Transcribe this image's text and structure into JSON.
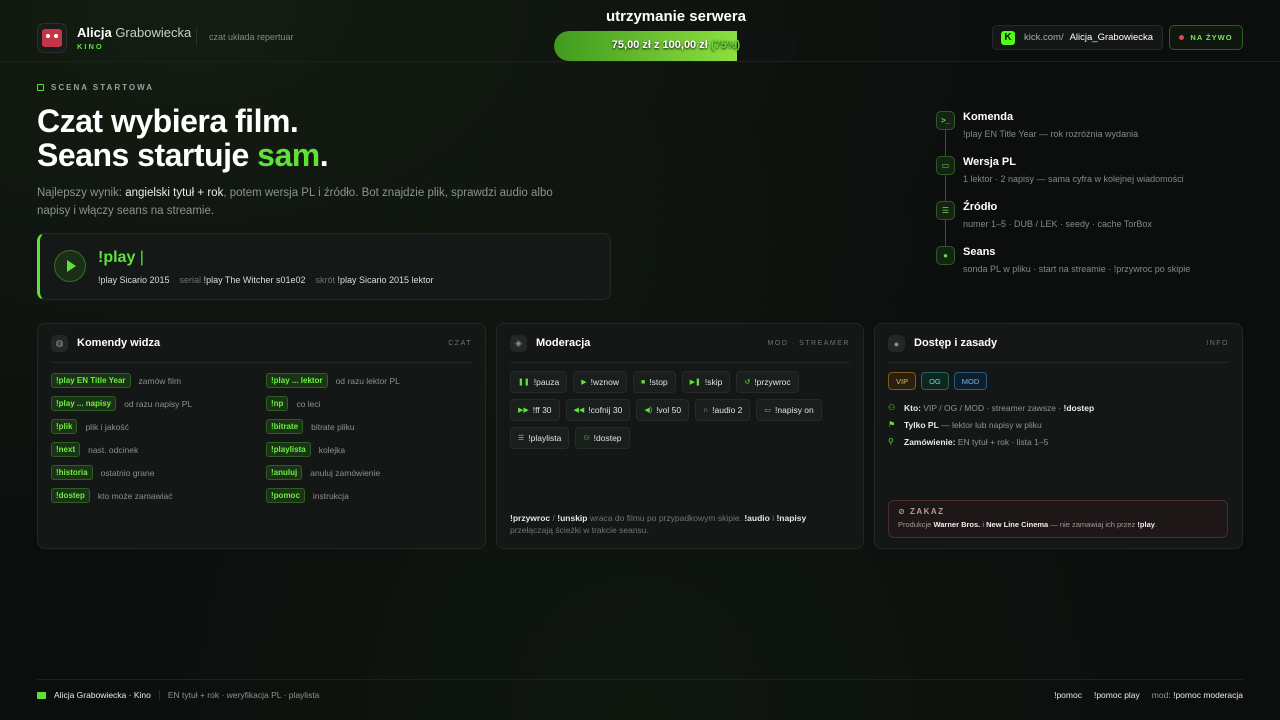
{
  "header": {
    "brand_first": "Alicja",
    "brand_last": "Grabowiecka",
    "brand_sub": "KINO",
    "tagline": "czat układa repertuar",
    "goal_title": "utrzymanie serwera",
    "goal_amount": "75,00 zł z 100,00 zł",
    "goal_percent": "(75%)",
    "goal_progress": 0.75,
    "kick_url": "kick.com/",
    "kick_user": "Alicja_Grabowiecka",
    "live_label": "NA ŻYWO"
  },
  "hero": {
    "eyebrow": "SCENA STARTOWA",
    "title_line1": "Czat wybiera film.",
    "title_line2_a": "Seans startuje ",
    "title_line2_b": "sam",
    "title_line2_c": ".",
    "desc_1": "Najlepszy wynik: ",
    "desc_2": "angielski tytuł + rok",
    "desc_3": ", potem wersja PL i źródło. Bot znajdzie plik, sprawdzi audio albo napisy i włączy seans na streamie.",
    "play_cmd": "!play",
    "play_cursor": "|",
    "ex1": "!play Sicario 2015",
    "ex2_lbl": "serial",
    "ex2": "!play The Witcher s01e02",
    "ex3_lbl": "skrót",
    "ex3": "!play Sicario 2015 lektor"
  },
  "steps": [
    {
      "icon": "terminal-icon",
      "title": "Komenda",
      "desc": "!play EN Title Year — rok rozróżnia wydania"
    },
    {
      "icon": "screen-icon",
      "title": "Wersja PL",
      "desc": "1 lektor · 2 napisy — sama cyfra w kolejnej wiadomości"
    },
    {
      "icon": "list-icon",
      "title": "Źródło",
      "desc": "numer 1–5 · DUB / LEK · seedy · cache TorBox"
    },
    {
      "icon": "play-circle-icon",
      "title": "Seans",
      "desc": "sonda PL w pliku · start na streamie · !przywroc po skipie"
    }
  ],
  "viewer_card": {
    "title": "Komendy widza",
    "tag": "CZAT",
    "commands": [
      {
        "cmd": "!play EN Title Year",
        "desc": "zamów film"
      },
      {
        "cmd": "!play ... lektor",
        "desc": "od razu lektor PL"
      },
      {
        "cmd": "!play ... napisy",
        "desc": "od razu napisy PL"
      },
      {
        "cmd": "!np",
        "desc": "co leci"
      },
      {
        "cmd": "!plik",
        "desc": "plik i jakość"
      },
      {
        "cmd": "!bitrate",
        "desc": "bitrate pliku"
      },
      {
        "cmd": "!next",
        "desc": "nast. odcinek"
      },
      {
        "cmd": "!playlista",
        "desc": "kolejka"
      },
      {
        "cmd": "!historia",
        "desc": "ostatnio grane"
      },
      {
        "cmd": "!anuluj",
        "desc": "anuluj zamówienie"
      },
      {
        "cmd": "!dostep",
        "desc": "kto może zamawiać"
      },
      {
        "cmd": "!pomoc",
        "desc": "instrukcja"
      }
    ]
  },
  "mod_card": {
    "title": "Moderacja",
    "tag": "MOD · STREAMER",
    "commands": [
      {
        "icon": "pause-icon",
        "glyph": "❚❚",
        "label": "!pauza"
      },
      {
        "icon": "play-icon",
        "glyph": "▶",
        "label": "!wznow"
      },
      {
        "icon": "stop-icon",
        "glyph": "■",
        "label": "!stop"
      },
      {
        "icon": "skip-icon",
        "glyph": "▶❚",
        "label": "!skip"
      },
      {
        "icon": "restore-icon",
        "glyph": "↺",
        "label": "!przywroc"
      },
      {
        "icon": "forward-icon",
        "glyph": "▶▶",
        "label": "!ff 30"
      },
      {
        "icon": "rewind-icon",
        "glyph": "◀◀",
        "label": "!cofnij 30"
      },
      {
        "icon": "volume-icon",
        "glyph": "◀)",
        "label": "!vol 50"
      },
      {
        "icon": "headphones-icon",
        "glyph": "∩",
        "label": "!audio 2"
      },
      {
        "icon": "subtitles-icon",
        "glyph": "▭",
        "label": "!napisy on"
      },
      {
        "icon": "playlist-icon",
        "glyph": "☰",
        "label": "!playlista"
      },
      {
        "icon": "user-add-icon",
        "glyph": "⚇",
        "label": "!dostep"
      }
    ],
    "note_1": "!przywroc",
    "note_2": " / ",
    "note_3": "!unskip",
    "note_4": " wraca do filmu po przypadkowym skipie. ",
    "note_5": "!audio",
    "note_6": " i ",
    "note_7": "!napisy",
    "note_8": " przełączają ścieżki w trakcie seansu."
  },
  "access_card": {
    "title": "Dostęp i zasady",
    "tag": "INFO",
    "badges": [
      "VIP",
      "OG",
      "MOD"
    ],
    "row1_lbl": "Kto:",
    "row1_txt": " VIP / OG / MOD · streamer zawsze · ",
    "row1_cmd": "!dostep",
    "row2_lbl": "Tylko PL",
    "row2_txt": " — lektor lub napisy w pliku",
    "row3_lbl": "Zamówienie:",
    "row3_txt": " EN tytuł + rok · lista 1–5",
    "ban_title": "ZAKAZ",
    "ban_1": "Produkcje ",
    "ban_2": "Warner Bros.",
    "ban_3": " i ",
    "ban_4": "New Line Cinema",
    "ban_5": " — nie zamawiaj ich przez ",
    "ban_6": "!play",
    "ban_7": "."
  },
  "footer": {
    "brand": "Alicja Grabowiecka · Kino",
    "tagline": "EN tytuł + rok · weryfikacja PL · playlista",
    "help1": "!pomoc",
    "help2": "!pomoc play",
    "mod_lbl": "mod:",
    "mod_cmd": "!pomoc moderacja"
  },
  "colors": {
    "accent": "#5fe03a",
    "background": "#0c0e0d",
    "card": "#141716",
    "kick": "#53fc18",
    "live_dot": "#e04848"
  }
}
